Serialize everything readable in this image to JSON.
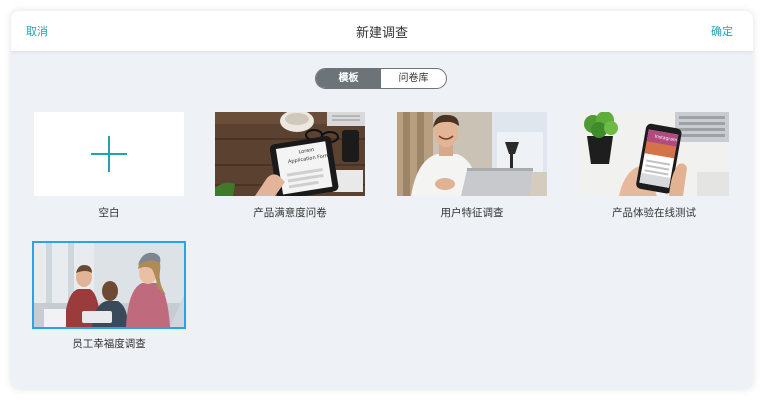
{
  "header": {
    "cancel_label": "取消",
    "title": "新建调查",
    "confirm_label": "确定"
  },
  "tabs": [
    {
      "label": "模板",
      "active": true
    },
    {
      "label": "问卷库",
      "active": false
    }
  ],
  "templates": [
    {
      "label": "空白",
      "kind": "blank"
    },
    {
      "label": "产品满意度问卷",
      "kind": "photo-tablet-application-form"
    },
    {
      "label": "用户特征调查",
      "kind": "photo-man-laptop"
    },
    {
      "label": "产品体验在线测试",
      "kind": "photo-phone-app"
    },
    {
      "label": "员工幸福度调查",
      "kind": "photo-team-office",
      "selected": true
    }
  ],
  "colors": {
    "accent": "#1fa2b3",
    "tab_active_bg": "#6d7479",
    "selected_border": "#2ea2e8",
    "dialog_bg": "#eef1f6"
  },
  "image_text": {
    "tablet_form": [
      "Lorem",
      "Application Form"
    ],
    "phone_app": "Instagram"
  }
}
